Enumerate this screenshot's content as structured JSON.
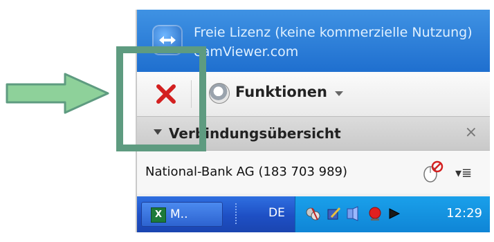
{
  "license": {
    "line1": "Freie Lizenz (keine kommerzielle Nutzung)",
    "line2": "eamViewer.com"
  },
  "toolbar": {
    "functions_label": "Funktionen"
  },
  "section": {
    "title": "Verbindungsübersicht",
    "close_glyph": "×"
  },
  "connection": {
    "name": "National-Bank AG (183 703 989)",
    "menu_glyph": "▾≣"
  },
  "taskbar": {
    "app_button_label": "M..",
    "language": "DE",
    "clock": "12:29"
  },
  "colors": {
    "header_blue": "#2a7bd8",
    "highlight_green": "#5e9b80",
    "close_red": "#d32020",
    "taskbar_blue": "#1e4fc4",
    "tray_blue": "#1293e0"
  },
  "icons": {
    "app": "teamviewer-logo-icon",
    "close": "close-x-icon",
    "functions": "webcam-icon",
    "mouse": "mouse-control-icon",
    "excel": "excel-icon"
  }
}
